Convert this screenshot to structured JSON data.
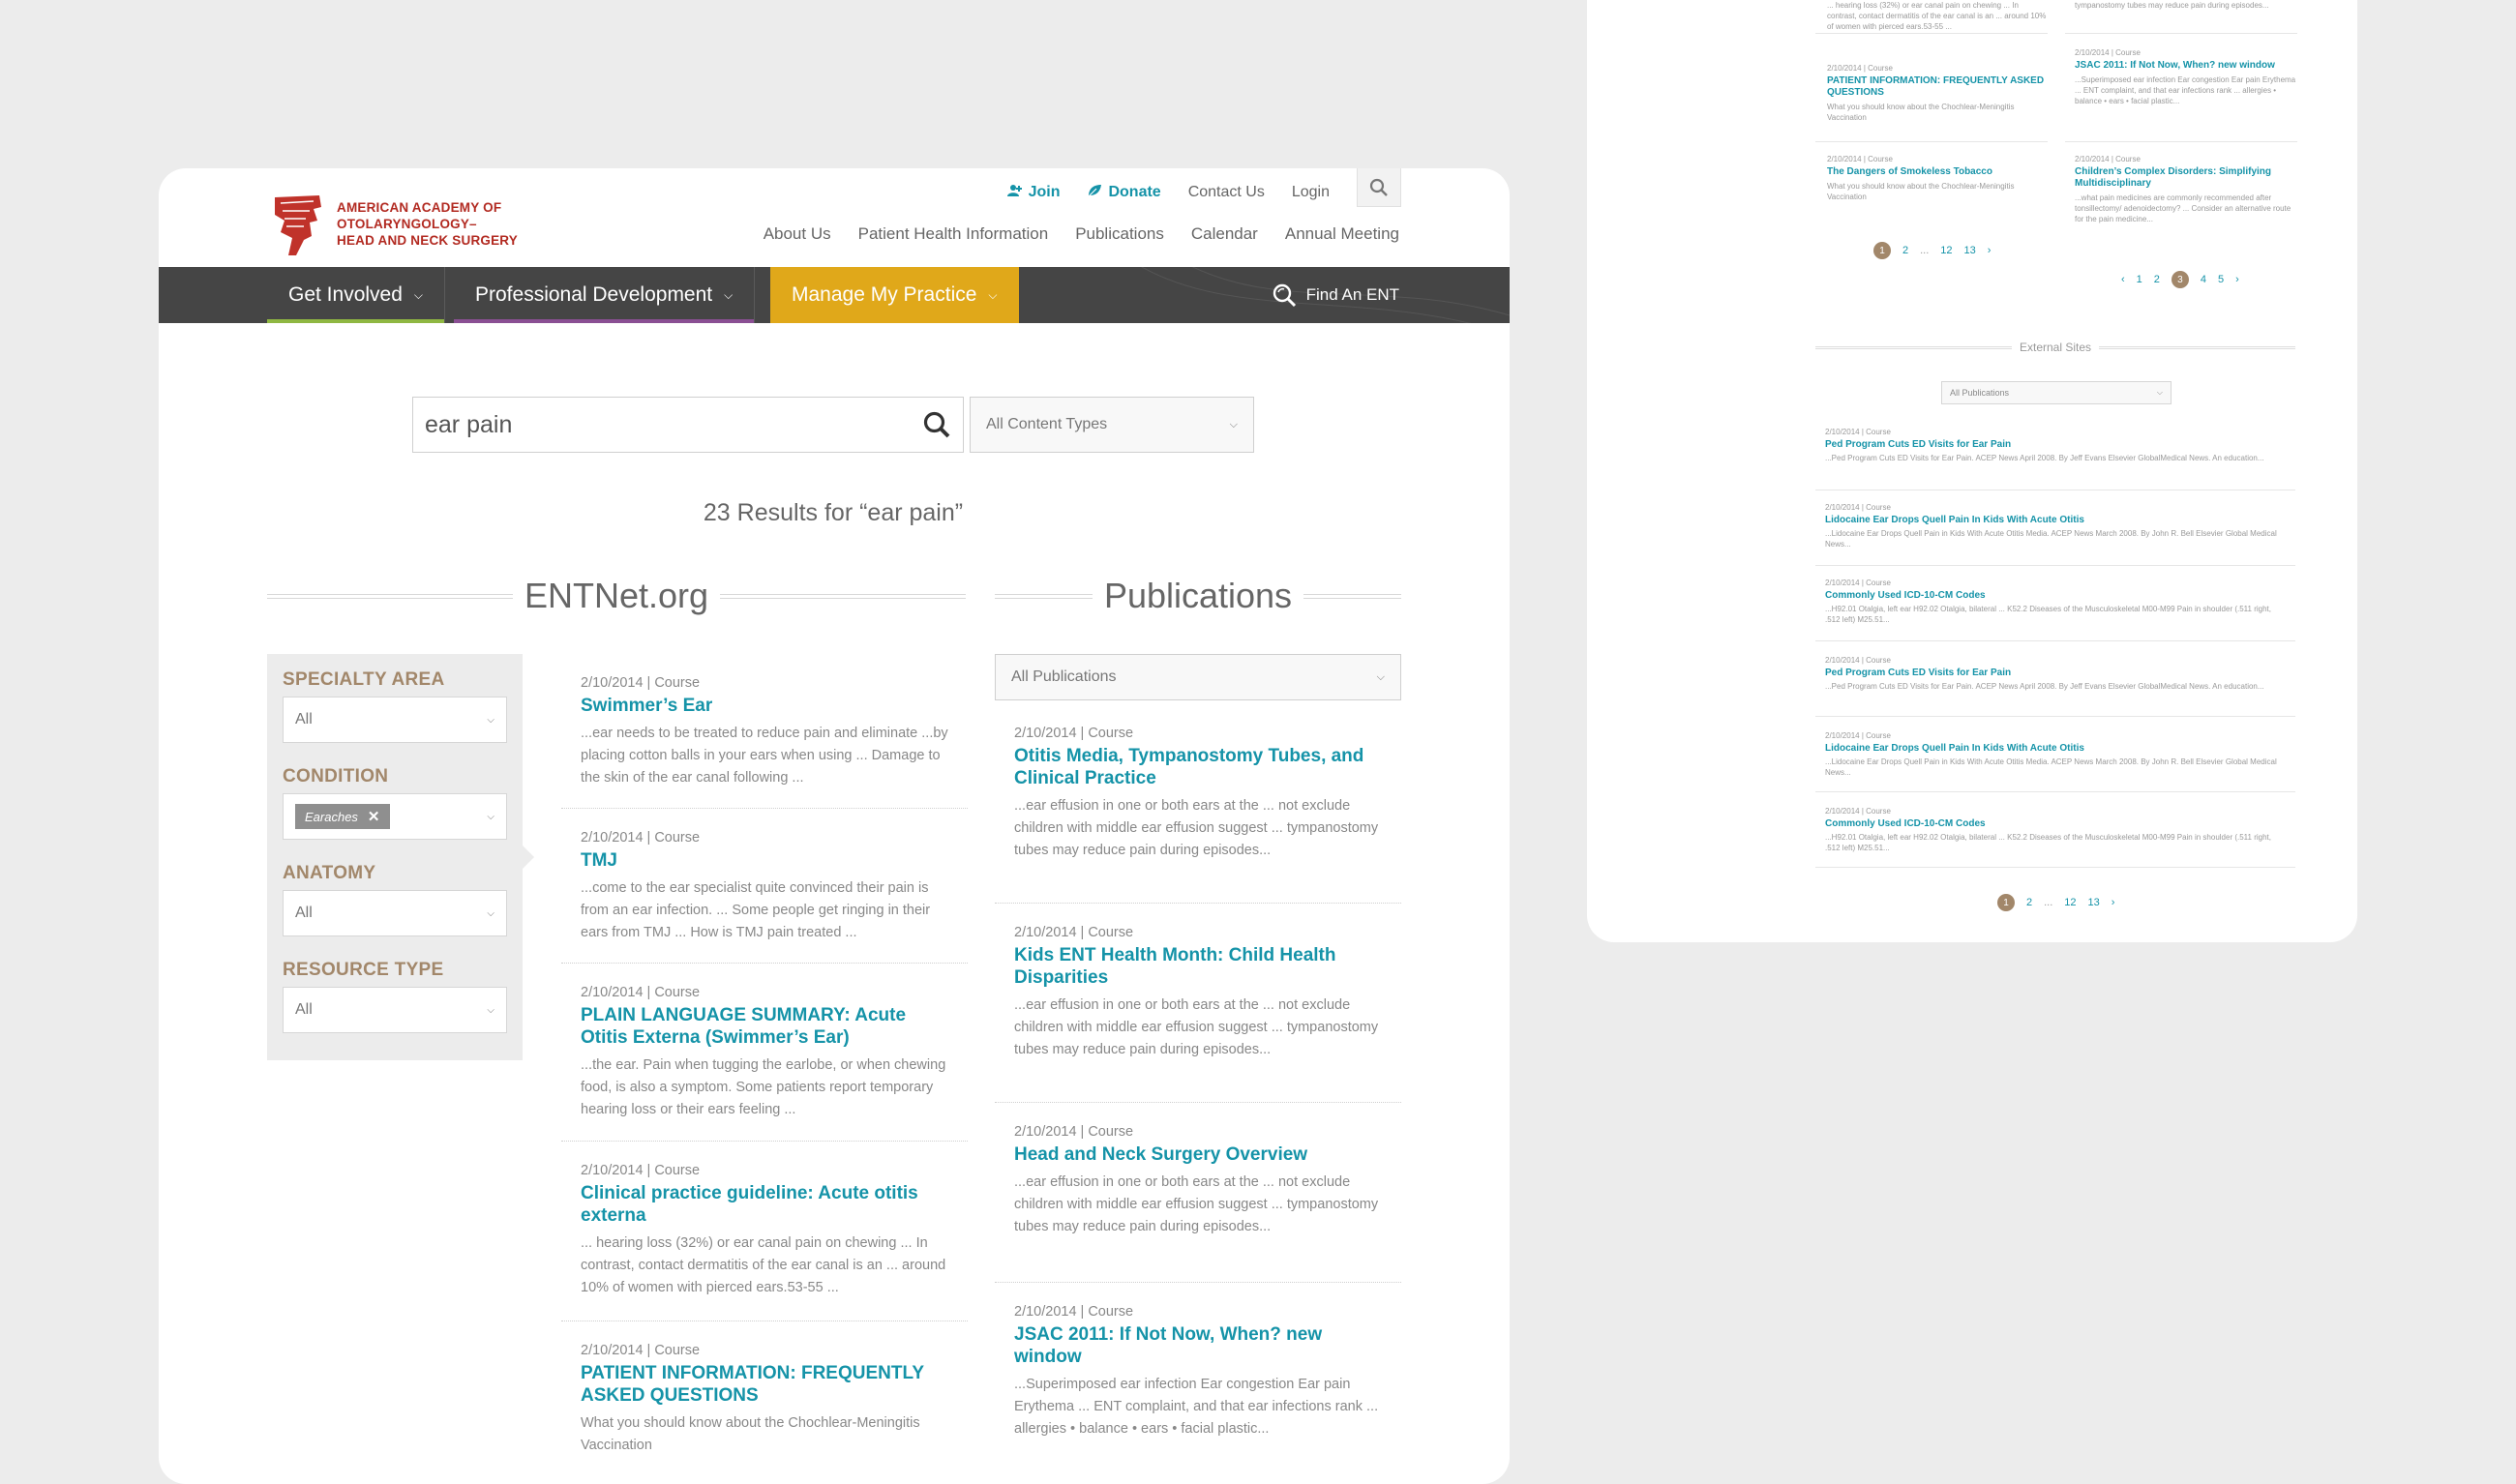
{
  "logo": {
    "text_lines": [
      "American Academy of",
      "Otolaryngology–",
      "Head and Neck Surgery"
    ]
  },
  "util_nav": {
    "join": "Join",
    "donate": "Donate",
    "contact": "Contact Us",
    "login": "Login"
  },
  "main_nav": [
    "About Us",
    "Patient Health Information",
    "Publications",
    "Calendar",
    "Annual Meeting"
  ],
  "primary_nav": {
    "get_involved": "Get Involved",
    "professional_dev": "Professional Development",
    "manage_practice": "Manage My Practice",
    "find_ent": "Find An ENT"
  },
  "search": {
    "query": "ear pain",
    "content_types": "All Content Types",
    "results_text": "23 Results for “ear pain”"
  },
  "sections": {
    "entnet": "ENTNet.org",
    "publications": "Publications"
  },
  "filters": {
    "specialty_label": "Specialty Area",
    "specialty_value": "All",
    "condition_label": "Condition",
    "condition_chip": "Earaches",
    "anatomy_label": "Anatomy",
    "anatomy_value": "All",
    "resource_label": "Resource Type",
    "resource_value": "All"
  },
  "entnet_results": [
    {
      "meta": "2/10/2014 | Course",
      "title": "Swimmer’s Ear",
      "snippet": "...ear needs to be treated to reduce pain and eliminate ...by placing cotton balls in your ears when using ... Damage to the skin of the ear canal following ..."
    },
    {
      "meta": "2/10/2014 | Course",
      "title": "TMJ",
      "snippet": "...come to the ear specialist quite convinced their pain is from an ear infection. ... Some people get ringing in their ears from TMJ ... How is TMJ pain treated ..."
    },
    {
      "meta": "2/10/2014 | Course",
      "title": "PLAIN LANGUAGE SUMMARY: Acute Otitis Externa (Swimmer’s Ear)",
      "snippet": "...the ear. Pain when tugging the earlobe, or when chewing food, is also a symptom. Some patients report temporary hearing loss or their ears feeling ..."
    },
    {
      "meta": "2/10/2014 | Course",
      "title": "Clinical practice guideline: Acute otitis externa",
      "snippet": "... hearing loss (32%) or ear canal pain on chewing ... In contrast, contact dermatitis of the ear canal is an ... around 10% of women with pierced ears.53-55 ..."
    },
    {
      "meta": "2/10/2014 | Course",
      "title": "PATIENT INFORMATION: FREQUENTLY ASKED QUESTIONS",
      "snippet": "What you should know about the Chochlear-Meningitis Vaccination"
    }
  ],
  "publications": {
    "select": "All Publications",
    "results": [
      {
        "meta": "2/10/2014 | Course",
        "title": "Otitis Media, Tympanostomy Tubes, and Clinical Practice",
        "snippet": "...ear effusion in one or both ears at the ... not exclude children with middle ear effusion suggest ... tympanostomy tubes may reduce pain during episodes..."
      },
      {
        "meta": "2/10/2014 | Course",
        "title": "Kids ENT Health Month: Child Health Disparities",
        "snippet": "...ear effusion in one or both ears at the ... not exclude children with middle ear effusion suggest ... tympanostomy tubes may reduce pain during episodes..."
      },
      {
        "meta": "2/10/2014 | Course",
        "title": "Head and Neck Surgery Overview",
        "snippet": "...ear effusion in one or both ears at the ... not exclude children with middle ear effusion suggest ... tympanostomy tubes may reduce pain during episodes..."
      },
      {
        "meta": "2/10/2014 | Course",
        "title": "JSAC 2011: If Not Now, When? new window",
        "snippet": "...Superimposed ear infection Ear congestion Ear pain Erythema ... ENT complaint, and that ear infections rank ... allergies • balance • ears • facial plastic..."
      }
    ]
  },
  "side": {
    "top_left_snippet": "... hearing loss (32%) or ear canal pain on chewing ... In contrast, contact dermatitis of the ear canal is an ... around 10% of women with pierced ears.53-55 ...",
    "top_right_snippet": "tympanostomy tubes may reduce pain during episodes...",
    "left_items": [
      {
        "meta": "2/10/2014 | Course",
        "title": "PATIENT INFORMATION: FREQUENTLY ASKED QUESTIONS",
        "snippet": "What you should know about the Chochlear-Meningitis Vaccination"
      },
      {
        "meta": "2/10/2014 | Course",
        "title": "The Dangers of Smokeless Tobacco",
        "snippet": "What you should know about the Chochlear-Meningitis Vaccination"
      }
    ],
    "right_items": [
      {
        "meta": "2/10/2014 | Course",
        "title": "JSAC 2011: If Not Now, When? new window",
        "snippet": "...Superimposed ear infection Ear congestion Ear pain Erythema ... ENT complaint, and that ear infections rank ... allergies • balance • ears • facial plastic..."
      },
      {
        "meta": "2/10/2014 | Course",
        "title": "Children’s Complex Disorders: Simplifying Multidisciplinary",
        "snippet": "...what pain medicines are commonly recommended after tonsillectomy/ adenoidectomy? ... Consider an alternative route for the pain medicine..."
      }
    ],
    "pager_left": [
      "1",
      "2",
      "...",
      "12",
      "13"
    ],
    "pager_right": [
      "1",
      "2",
      "3",
      "4",
      "5"
    ],
    "external_title": "External Sites",
    "external_select": "All Publications",
    "external_items": [
      {
        "meta": "2/10/2014 | Course",
        "title": "Ped Program Cuts ED Visits for Ear Pain",
        "snippet": "...Ped Program Cuts ED Visits for Ear Pain. ACEP News April 2008. By Jeff Evans Elsevier GlobalMedical News. An education..."
      },
      {
        "meta": "2/10/2014 | Course",
        "title": "Lidocaine Ear Drops Quell Pain In Kids With Acute Otitis",
        "snippet": "...Lidocaine Ear Drops Quell Pain in Kids With Acute Otitis Media. ACEP News March 2008. By John R. Bell Elsevier Global Medical News..."
      },
      {
        "meta": "2/10/2014 | Course",
        "title": "Commonly Used ICD-10-CM Codes",
        "snippet": "...H92.01 Otalgia, left ear H92.02 Otalgia, bilateral ... K52.2 Diseases of the Musculoskeletal M00-M99 Pain in shoulder (.511 right, .512 left) M25.51..."
      },
      {
        "meta": "2/10/2014 | Course",
        "title": "Ped Program Cuts ED Visits for Ear Pain",
        "snippet": "...Ped Program Cuts ED Visits for Ear Pain. ACEP News April 2008. By Jeff Evans Elsevier GlobalMedical News. An education..."
      },
      {
        "meta": "2/10/2014 | Course",
        "title": "Lidocaine Ear Drops Quell Pain In Kids With Acute Otitis",
        "snippet": "...Lidocaine Ear Drops Quell Pain in Kids With Acute Otitis Media. ACEP News March 2008. By John R. Bell Elsevier Global Medical News..."
      },
      {
        "meta": "2/10/2014 | Course",
        "title": "Commonly Used ICD-10-CM Codes",
        "snippet": "...H92.01 Otalgia, left ear H92.02 Otalgia, bilateral ... K52.2 Diseases of the Musculoskeletal M00-M99 Pain in shoulder (.511 right, .512 left) M25.51..."
      }
    ],
    "pager_bottom": [
      "1",
      "2",
      "...",
      "12",
      "13"
    ]
  },
  "colors": {
    "teal": "#1593a8",
    "brand_red": "#b22a21",
    "gold": "#e0a81a",
    "tan": "#a2876a",
    "nav_dark": "#454545"
  },
  "icons": [
    "user-plus-icon",
    "leaf-icon",
    "search-icon",
    "chevron-down-icon",
    "close-icon",
    "chevron-left-icon",
    "chevron-right-icon"
  ]
}
